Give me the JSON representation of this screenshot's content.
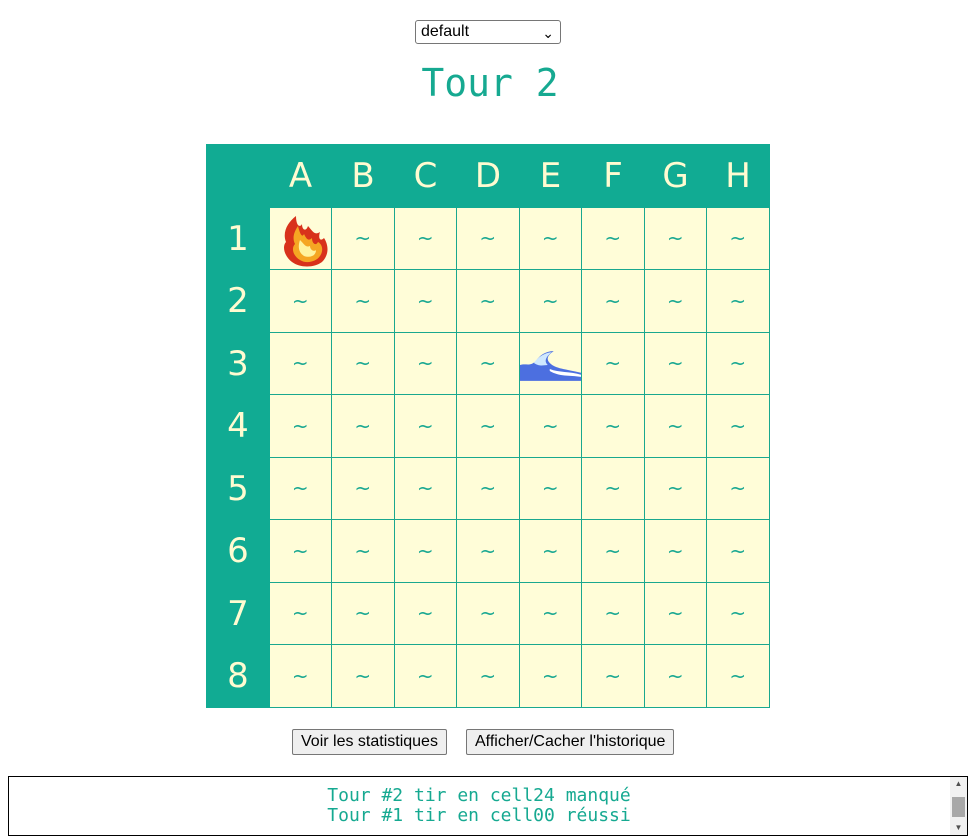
{
  "mode_select": {
    "value": "default"
  },
  "title": "Tour 2",
  "board": {
    "columns": [
      "A",
      "B",
      "C",
      "D",
      "E",
      "F",
      "G",
      "H"
    ],
    "rows": [
      "1",
      "2",
      "3",
      "4",
      "5",
      "6",
      "7",
      "8"
    ],
    "water_symbol": "~",
    "cells": {
      "0-0": {
        "state": "hit",
        "icon": "fire-icon"
      },
      "2-4": {
        "state": "miss",
        "icon": "wave-icon"
      }
    }
  },
  "buttons": {
    "stats_label": "Voir les statistiques",
    "history_toggle_label": "Afficher/Cacher l'historique"
  },
  "history": [
    "Tour #2 tir en cell24 manqué",
    "Tour #1 tir en cell00 réussi"
  ],
  "colors": {
    "accent": "#11ab93",
    "cell_bg": "#fffdd8",
    "header_text": "#fffbd1"
  }
}
